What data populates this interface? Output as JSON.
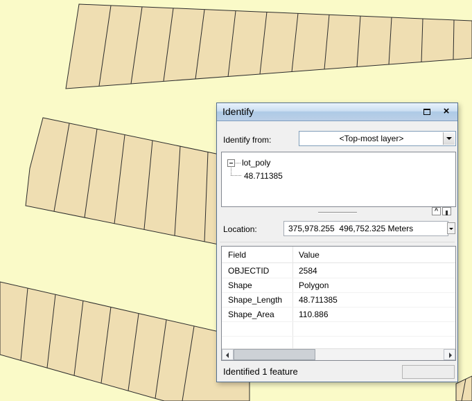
{
  "window": {
    "title": "Identify",
    "controls": {
      "close_glyph": "×",
      "collapse_glyph": "^"
    },
    "identify_from": {
      "label": "Identify from:",
      "value": "<Top-most layer>"
    },
    "tree": {
      "root": "lot_poly",
      "child": "48.711385"
    },
    "location": {
      "label": "Location:",
      "value": "375,978.255  496,752.325 Meters"
    },
    "table": {
      "columns": {
        "field": "Field",
        "value": "Value"
      },
      "rows": [
        {
          "field": "OBJECTID",
          "value": "2584"
        },
        {
          "field": "Shape",
          "value": "Polygon"
        },
        {
          "field": "Shape_Length",
          "value": "48.711385"
        },
        {
          "field": "Shape_Area",
          "value": "110.886"
        }
      ]
    },
    "status": "Identified 1 feature"
  },
  "map": {
    "background_color": "#FAFAC8",
    "parcel_fill": "#EFDEB2",
    "parcel_outline": "#2B2B2B"
  }
}
